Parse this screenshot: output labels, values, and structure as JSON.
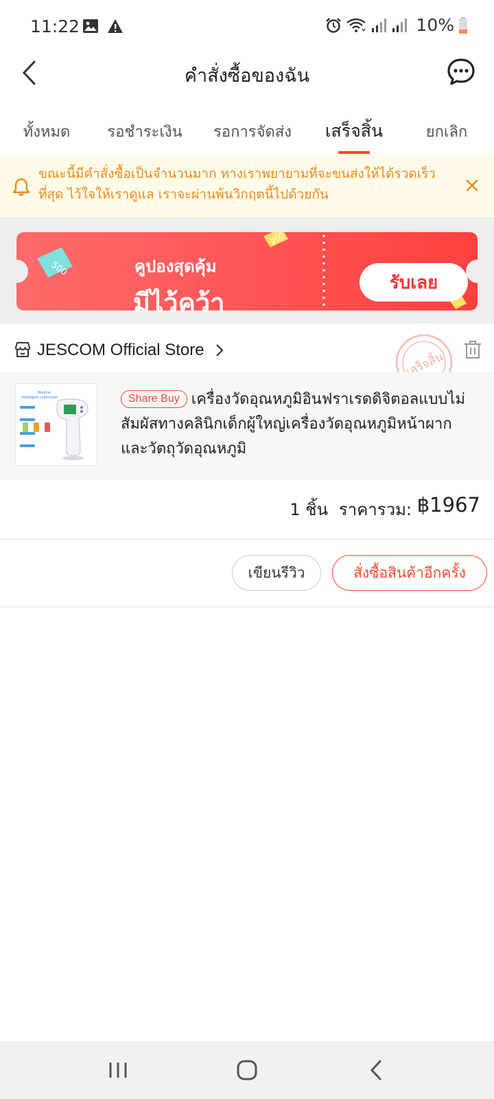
{
  "status_bar": {
    "time": "11:22",
    "battery": "10%",
    "icons": [
      "image-icon",
      "warning-icon",
      "alarm-icon",
      "wifi-icon",
      "signal-icon",
      "signal-icon",
      "battery-icon"
    ]
  },
  "header": {
    "title": "คำสั่งซื้อของฉัน",
    "back_icon": "chevron-left-icon",
    "chat_icon": "chat-icon"
  },
  "tabs": [
    {
      "label": "ทั้งหมด",
      "active": false
    },
    {
      "label": "รอชำระเงิน",
      "active": false
    },
    {
      "label": "รอการจัดส่ง",
      "active": false
    },
    {
      "label": "เสร็จสิ้น",
      "active": true
    },
    {
      "label": "ยกเลิก",
      "active": false
    }
  ],
  "notice": {
    "text": "ขณะนี้มีคำสั่งซื้อเป็นจำนวนมาก ทางเราพยายามที่จะขนส่งให้ได้รวดเร็วที่สุด ไว้ใจให้เราดูแล เราจะผ่านพ้นวิกฤตนี้ไปด้วยกัน",
    "color": "#f0891c"
  },
  "coupon": {
    "line1": "คูปองสุดคุ้ม",
    "line2": "มีไว้คว้า",
    "button": "รับเลย",
    "tag_left": "500",
    "tag_right": "200",
    "color": "#ff4f4f"
  },
  "order": {
    "store_name": "JESCOM Official Store",
    "stamp_text": "เสร็จสิ้น",
    "badge": "Share Buy",
    "product_name": "เครื่องวัดอุณหภูมิอินฟราเรดดิจิตอลแบบไม่สัมผัสทางคลินิกเด็กผู้ใหญ่เครื่องวัดอุณหภูมิหน้าผากและวัตถุวัดอุณหภูมิ",
    "product_image_text": "Medical\nIntelligent calibration",
    "quantity": "1 ชิ้น",
    "total_label": "ราคารวม:",
    "total_price": "฿1967",
    "review_button": "เขียนรีวิว",
    "reorder_button": "สั่งซื้อสินค้าอีกครั้ง"
  },
  "nav_bar": {
    "icons": [
      "recent-apps-icon",
      "home-icon",
      "back-icon"
    ]
  },
  "accent_color": "#ee4d2d"
}
